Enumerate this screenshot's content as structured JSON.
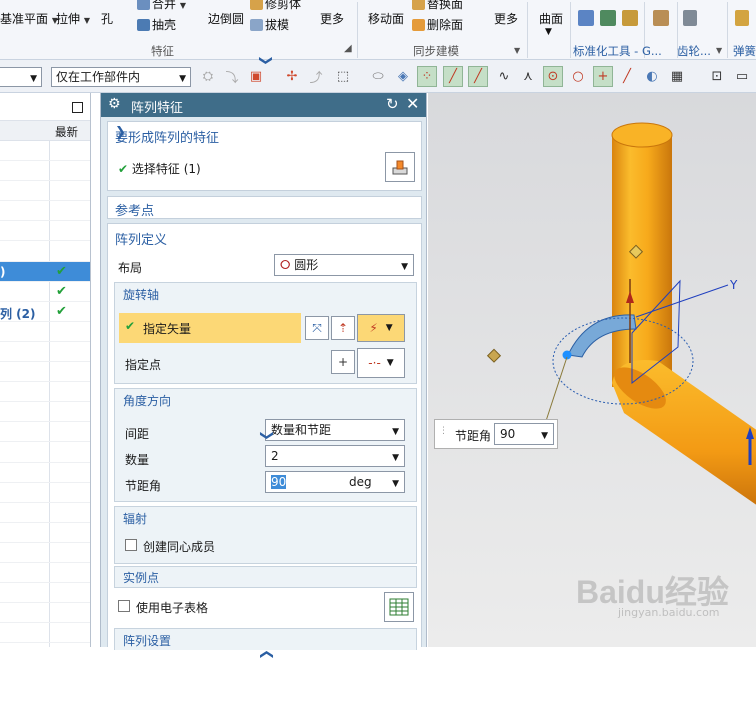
{
  "ribbon": {
    "items": {
      "datum_plane": "基准平面",
      "extrude": "拉伸",
      "hole": "孔",
      "unite": "合并",
      "shell": "抽壳",
      "edge_blend": "边倒圆",
      "trim_body": "修剪体",
      "draft": "拔模",
      "more1": "更多",
      "move_face": "移动面",
      "replace_face": "替换面",
      "delete_face": "删除面",
      "more2": "更多",
      "surface": "曲面"
    },
    "groups": {
      "feature": "特征",
      "sync_modeling": "同步建模",
      "std_tools": "标准化工具 - G...",
      "gear": "齿轮...",
      "spring": "弹簧..."
    }
  },
  "toolbar": {
    "filter_value": "",
    "scope_value": "仅在工作部件内"
  },
  "nav": {
    "col_header": "最新",
    "rows": [
      {
        "text": "",
        "check": ""
      },
      {
        "text": "",
        "check": ""
      },
      {
        "text": "",
        "check": ""
      },
      {
        "text": "",
        "check": ""
      },
      {
        "text": "",
        "check": ""
      },
      {
        "text": "",
        "check": ""
      },
      {
        "text": ")",
        "check": "✔"
      },
      {
        "text": "",
        "check": "✔"
      },
      {
        "text": "列 (2)",
        "check": "✔"
      },
      {
        "text": "",
        "check": ""
      },
      {
        "text": "",
        "check": ""
      },
      {
        "text": "",
        "check": ""
      },
      {
        "text": "",
        "check": ""
      },
      {
        "text": "",
        "check": ""
      },
      {
        "text": "",
        "check": ""
      },
      {
        "text": "",
        "check": ""
      },
      {
        "text": "",
        "check": ""
      },
      {
        "text": "",
        "check": ""
      },
      {
        "text": "",
        "check": ""
      },
      {
        "text": "",
        "check": ""
      },
      {
        "text": "",
        "check": ""
      },
      {
        "text": "",
        "check": ""
      },
      {
        "text": "",
        "check": ""
      },
      {
        "text": "",
        "check": ""
      },
      {
        "text": "",
        "check": ""
      }
    ]
  },
  "dialog": {
    "title": "阵列特征",
    "sec_feature": {
      "title": "要形成阵列的特征",
      "select_label": "选择特征 (1)"
    },
    "sec_ref": {
      "title": "参考点"
    },
    "sec_def": {
      "title": "阵列定义",
      "layout_label": "布局",
      "layout_value": "圆形",
      "rot_axis": {
        "title": "旋转轴",
        "vector_label": "指定矢量",
        "point_label": "指定点"
      },
      "angle_dir": {
        "title": "角度方向",
        "spacing_label": "间距",
        "spacing_value": "数量和节距",
        "count_label": "数量",
        "count_value": "2",
        "pitch_label": "节距角",
        "pitch_value": "90",
        "pitch_unit": "deg"
      },
      "radial": {
        "title": "辐射",
        "concentric_label": "创建同心成员"
      },
      "instance": {
        "title": "实例点"
      },
      "spreadsheet_label": "使用电子表格",
      "settings": {
        "title": "阵列设置"
      }
    }
  },
  "viewport": {
    "tooltip_label": "节距角",
    "tooltip_value": "90",
    "axis_y": "Y",
    "watermark": "Baidu经验",
    "watermark_url": "jingyan.baidu.com"
  },
  "colors": {
    "dialog_title_bg": "#3f6d89",
    "section_header": "#2b5fa3",
    "highlight_row": "#fcd876",
    "selection_blue": "#3e8cd8",
    "pipe_orange": "#f7a91b",
    "check_green": "#22a03a"
  }
}
